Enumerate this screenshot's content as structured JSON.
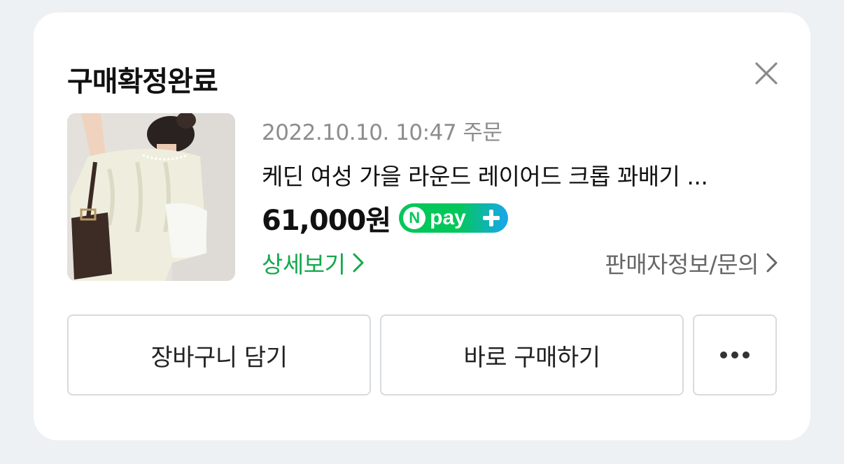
{
  "header": {
    "title": "구매확정완료",
    "close_icon": "close-icon"
  },
  "product": {
    "image_icon": "product-image",
    "order_date": "2022.10.10. 10:47 주문",
    "name": "케딘 여성 가을 라운드 레이어드 크롭 꽈배기 ...",
    "price": "61,000원",
    "npay": {
      "n_label": "N",
      "pay_label": "pay",
      "plus_icon": "plus-icon"
    }
  },
  "links": {
    "detail_label": "상세보기",
    "seller_label": "판매자정보/문의",
    "chevron_icon": "chevron-right-icon"
  },
  "actions": {
    "cart_label": "장바구니 담기",
    "buy_label": "바로 구매하기",
    "more_icon": "more-horizontal-icon"
  },
  "colors": {
    "accent_green": "#14a84c",
    "npay_green": "#03c75a",
    "npay_blue": "#18a6f0",
    "background": "#eef1f3",
    "card": "#ffffff"
  }
}
